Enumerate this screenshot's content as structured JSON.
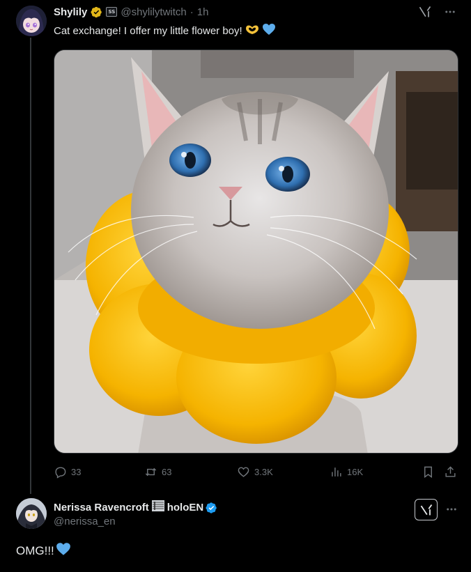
{
  "tweet": {
    "author_name": "Shylily",
    "affiliate_badge_text": "SS",
    "author_handle": "@shylilytwitch",
    "separator": "·",
    "time": "1h",
    "text": "Cat exchange! I offer my little flower boy!",
    "emojis": [
      "heart-hands-emoji",
      "blue-heart-emoji"
    ],
    "media": {
      "alt": "Grey tabby cat with blue eyes wearing a yellow plush flower collar",
      "collar_color": "#f5b800"
    },
    "stats": {
      "replies": "33",
      "reposts": "63",
      "likes": "3.3K",
      "views": "16K"
    }
  },
  "reply": {
    "author_name": "Nerissa Ravencroft",
    "author_name_suffix": "holoEN",
    "author_handle": "@nerissa_en",
    "text": "OMG!!!",
    "emojis": [
      "blue-heart-emoji"
    ]
  },
  "colors": {
    "background": "#000000",
    "text_primary": "#e7e9ea",
    "text_secondary": "#71767b",
    "verified_gold": "#e2b719",
    "verified_blue": "#1d9bf0",
    "thread_line": "#333639"
  },
  "icons": [
    "grok-icon",
    "more-icon",
    "reply-icon",
    "repost-icon",
    "like-icon",
    "views-icon",
    "bookmark-icon",
    "share-icon",
    "verified-badge-icon"
  ]
}
